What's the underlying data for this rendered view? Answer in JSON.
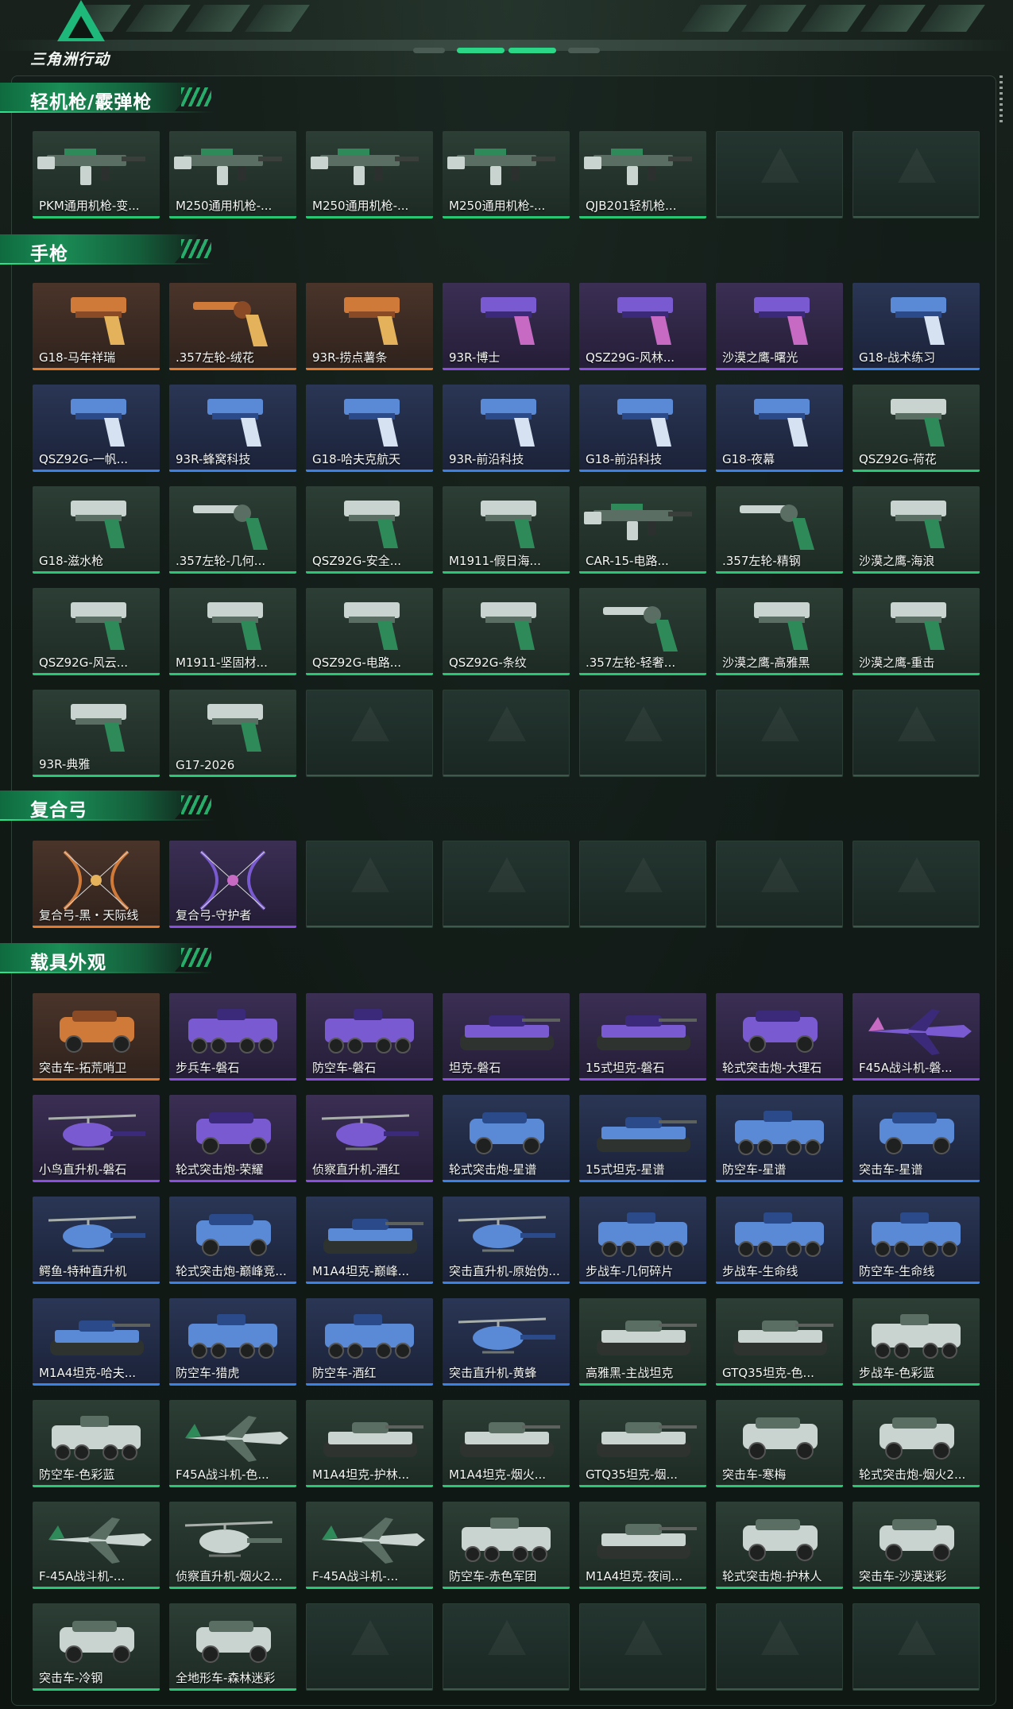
{
  "logo": {
    "name": "三角洲行动"
  },
  "sections": [
    {
      "title": "轻机枪/霰弹枪",
      "items": [
        {
          "label": "PKM通用机枪-变...",
          "rarity": "green",
          "kind": "lmg"
        },
        {
          "label": "M250通用机枪-...",
          "rarity": "green",
          "kind": "lmg"
        },
        {
          "label": "M250通用机枪-...",
          "rarity": "green",
          "kind": "lmg"
        },
        {
          "label": "M250通用机枪-...",
          "rarity": "green",
          "kind": "lmg"
        },
        {
          "label": "QJB201轻机枪...",
          "rarity": "green",
          "kind": "lmg"
        },
        {
          "label": "",
          "rarity": "empty",
          "kind": "empty"
        },
        {
          "label": "",
          "rarity": "empty",
          "kind": "empty"
        }
      ]
    },
    {
      "title": "手枪",
      "items": [
        {
          "label": "G18-马年祥瑞",
          "rarity": "orange",
          "kind": "pistol"
        },
        {
          "label": ".357左轮-绒花",
          "rarity": "orange",
          "kind": "revolver"
        },
        {
          "label": "93R-捞点薯条",
          "rarity": "orange",
          "kind": "pistol"
        },
        {
          "label": "93R-博士",
          "rarity": "purple",
          "kind": "pistol"
        },
        {
          "label": "QSZ29G-风林...",
          "rarity": "purple",
          "kind": "pistol"
        },
        {
          "label": "沙漠之鹰-曙光",
          "rarity": "purple",
          "kind": "pistol"
        },
        {
          "label": "G18-战术练习",
          "rarity": "blue",
          "kind": "pistol"
        },
        {
          "label": "QSZ92G-一帆...",
          "rarity": "blue",
          "kind": "pistol"
        },
        {
          "label": "93R-蜂窝科技",
          "rarity": "blue",
          "kind": "pistol"
        },
        {
          "label": "G18-哈夫克航天",
          "rarity": "blue",
          "kind": "pistol"
        },
        {
          "label": "93R-前沿科技",
          "rarity": "blue",
          "kind": "pistol"
        },
        {
          "label": "G18-前沿科技",
          "rarity": "blue",
          "kind": "pistol"
        },
        {
          "label": "G18-夜幕",
          "rarity": "blue",
          "kind": "pistol"
        },
        {
          "label": "QSZ92G-荷花",
          "rarity": "green",
          "kind": "pistol"
        },
        {
          "label": "G18-滋水枪",
          "rarity": "green",
          "kind": "pistol"
        },
        {
          "label": ".357左轮-几何...",
          "rarity": "green",
          "kind": "revolver"
        },
        {
          "label": "QSZ92G-安全...",
          "rarity": "green",
          "kind": "pistol"
        },
        {
          "label": "M1911-假日海...",
          "rarity": "green",
          "kind": "pistol"
        },
        {
          "label": "CAR-15-电路...",
          "rarity": "green",
          "kind": "rifle"
        },
        {
          "label": ".357左轮-精钢",
          "rarity": "green",
          "kind": "revolver"
        },
        {
          "label": "沙漠之鹰-海浪",
          "rarity": "green",
          "kind": "pistol"
        },
        {
          "label": "QSZ92G-风云...",
          "rarity": "green",
          "kind": "pistol"
        },
        {
          "label": "M1911-坚固材...",
          "rarity": "green",
          "kind": "pistol"
        },
        {
          "label": "QSZ92G-电路...",
          "rarity": "green",
          "kind": "pistol"
        },
        {
          "label": "QSZ92G-条纹",
          "rarity": "green",
          "kind": "pistol"
        },
        {
          "label": ".357左轮-轻奢...",
          "rarity": "green",
          "kind": "revolver"
        },
        {
          "label": "沙漠之鹰-高雅黑",
          "rarity": "green",
          "kind": "pistol"
        },
        {
          "label": "沙漠之鹰-重击",
          "rarity": "green",
          "kind": "pistol"
        },
        {
          "label": "93R-典雅",
          "rarity": "green",
          "kind": "pistol"
        },
        {
          "label": "G17-2026",
          "rarity": "green",
          "kind": "pistol"
        },
        {
          "label": "",
          "rarity": "empty",
          "kind": "empty"
        },
        {
          "label": "",
          "rarity": "empty",
          "kind": "empty"
        },
        {
          "label": "",
          "rarity": "empty",
          "kind": "empty"
        },
        {
          "label": "",
          "rarity": "empty",
          "kind": "empty"
        },
        {
          "label": "",
          "rarity": "empty",
          "kind": "empty"
        }
      ]
    },
    {
      "title": "复合弓",
      "items": [
        {
          "label": "复合弓-黑・天际线",
          "rarity": "orange",
          "kind": "bow"
        },
        {
          "label": "复合弓-守护者",
          "rarity": "purple",
          "kind": "bow"
        },
        {
          "label": "",
          "rarity": "empty",
          "kind": "empty"
        },
        {
          "label": "",
          "rarity": "empty",
          "kind": "empty"
        },
        {
          "label": "",
          "rarity": "empty",
          "kind": "empty"
        },
        {
          "label": "",
          "rarity": "empty",
          "kind": "empty"
        },
        {
          "label": "",
          "rarity": "empty",
          "kind": "empty"
        }
      ]
    },
    {
      "title": "载具外观",
      "items": [
        {
          "label": "突击车-拓荒哨卫",
          "rarity": "orange",
          "kind": "car"
        },
        {
          "label": "步兵车-磐石",
          "rarity": "purple",
          "kind": "apc"
        },
        {
          "label": "防空车-磐石",
          "rarity": "purple",
          "kind": "apc"
        },
        {
          "label": "坦克-磐石",
          "rarity": "purple",
          "kind": "tank"
        },
        {
          "label": "15式坦克-磐石",
          "rarity": "purple",
          "kind": "tank"
        },
        {
          "label": "轮式突击炮-大理石",
          "rarity": "purple",
          "kind": "car"
        },
        {
          "label": "F45A战斗机-磐...",
          "rarity": "purple",
          "kind": "jet"
        },
        {
          "label": "小鸟直升机-磐石",
          "rarity": "purple",
          "kind": "heli"
        },
        {
          "label": "轮式突击炮-荣耀",
          "rarity": "purple",
          "kind": "car"
        },
        {
          "label": "侦察直升机-酒红",
          "rarity": "purple",
          "kind": "heli"
        },
        {
          "label": "轮式突击炮-星谱",
          "rarity": "blue",
          "kind": "car"
        },
        {
          "label": "15式坦克-星谱",
          "rarity": "blue",
          "kind": "tank"
        },
        {
          "label": "防空车-星谱",
          "rarity": "blue",
          "kind": "apc"
        },
        {
          "label": "突击车-星谱",
          "rarity": "blue",
          "kind": "car"
        },
        {
          "label": "鳄鱼-特种直升机",
          "rarity": "blue",
          "kind": "heli"
        },
        {
          "label": "轮式突击炮-巅峰竞...",
          "rarity": "blue",
          "kind": "car"
        },
        {
          "label": "M1A4坦克-巅峰...",
          "rarity": "blue",
          "kind": "tank"
        },
        {
          "label": "突击直升机-原始伪...",
          "rarity": "blue",
          "kind": "heli"
        },
        {
          "label": "步战车-几何碎片",
          "rarity": "blue",
          "kind": "apc"
        },
        {
          "label": "步战车-生命线",
          "rarity": "blue",
          "kind": "apc"
        },
        {
          "label": "防空车-生命线",
          "rarity": "blue",
          "kind": "apc"
        },
        {
          "label": "M1A4坦克-哈夫...",
          "rarity": "blue",
          "kind": "tank"
        },
        {
          "label": "防空车-猎虎",
          "rarity": "blue",
          "kind": "apc"
        },
        {
          "label": "防空车-酒红",
          "rarity": "blue",
          "kind": "apc"
        },
        {
          "label": "突击直升机-黄蜂",
          "rarity": "blue",
          "kind": "heli"
        },
        {
          "label": "高雅黑-主战坦克",
          "rarity": "green",
          "kind": "tank"
        },
        {
          "label": "GTQ35坦克-色...",
          "rarity": "green",
          "kind": "tank"
        },
        {
          "label": "步战车-色彩蓝",
          "rarity": "green",
          "kind": "apc"
        },
        {
          "label": "防空车-色彩蓝",
          "rarity": "green",
          "kind": "apc"
        },
        {
          "label": "F45A战斗机-色...",
          "rarity": "green",
          "kind": "jet"
        },
        {
          "label": "M1A4坦克-护林...",
          "rarity": "green",
          "kind": "tank"
        },
        {
          "label": "M1A4坦克-烟火...",
          "rarity": "green",
          "kind": "tank"
        },
        {
          "label": "GTQ35坦克-烟...",
          "rarity": "green",
          "kind": "tank"
        },
        {
          "label": "突击车-寒梅",
          "rarity": "green",
          "kind": "car"
        },
        {
          "label": "轮式突击炮-烟火2...",
          "rarity": "green",
          "kind": "car"
        },
        {
          "label": "F-45A战斗机-...",
          "rarity": "green",
          "kind": "jet"
        },
        {
          "label": "侦察直升机-烟火2...",
          "rarity": "green",
          "kind": "heli"
        },
        {
          "label": "F-45A战斗机-...",
          "rarity": "green",
          "kind": "jet"
        },
        {
          "label": "防空车-赤色军团",
          "rarity": "green",
          "kind": "apc"
        },
        {
          "label": "M1A4坦克-夜间...",
          "rarity": "green",
          "kind": "tank"
        },
        {
          "label": "轮式突击炮-护林人",
          "rarity": "green",
          "kind": "car"
        },
        {
          "label": "突击车-沙漠迷彩",
          "rarity": "green",
          "kind": "car"
        },
        {
          "label": "突击车-冷钢",
          "rarity": "green",
          "kind": "car"
        },
        {
          "label": "全地形车-森林迷彩",
          "rarity": "green",
          "kind": "atv"
        },
        {
          "label": "",
          "rarity": "empty",
          "kind": "empty"
        },
        {
          "label": "",
          "rarity": "empty",
          "kind": "empty"
        },
        {
          "label": "",
          "rarity": "empty",
          "kind": "empty"
        },
        {
          "label": "",
          "rarity": "empty",
          "kind": "empty"
        },
        {
          "label": "",
          "rarity": "empty",
          "kind": "empty"
        }
      ]
    }
  ]
}
